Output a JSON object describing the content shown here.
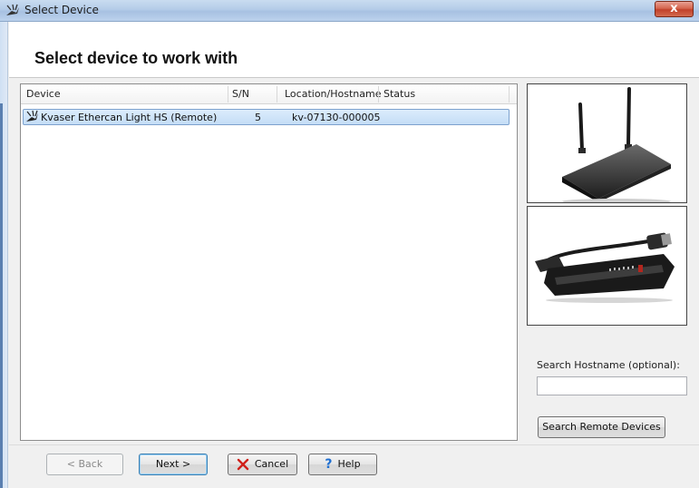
{
  "window": {
    "title": "Select Device",
    "close_label": "x"
  },
  "header": {
    "heading": "Select device to work with"
  },
  "device_list": {
    "columns": [
      "Device",
      "S/N",
      "Location/Hostname",
      "Status"
    ],
    "rows": [
      {
        "device": "Kvaser Ethercan Light HS (Remote)",
        "sn": "5",
        "location": "kv-07130-000005",
        "status": "",
        "selected": true
      }
    ]
  },
  "search": {
    "label": "Search Hostname (optional):",
    "value": "",
    "placeholder": "",
    "button_label": "Search Remote Devices"
  },
  "footer": {
    "back_label": "< Back",
    "next_label": "Next >",
    "cancel_label": "Cancel",
    "help_label": "Help"
  },
  "colors": {
    "selection": "#c4ddf6",
    "cancel_icon": "#d0201a",
    "help_icon": "#1f6fd1"
  }
}
